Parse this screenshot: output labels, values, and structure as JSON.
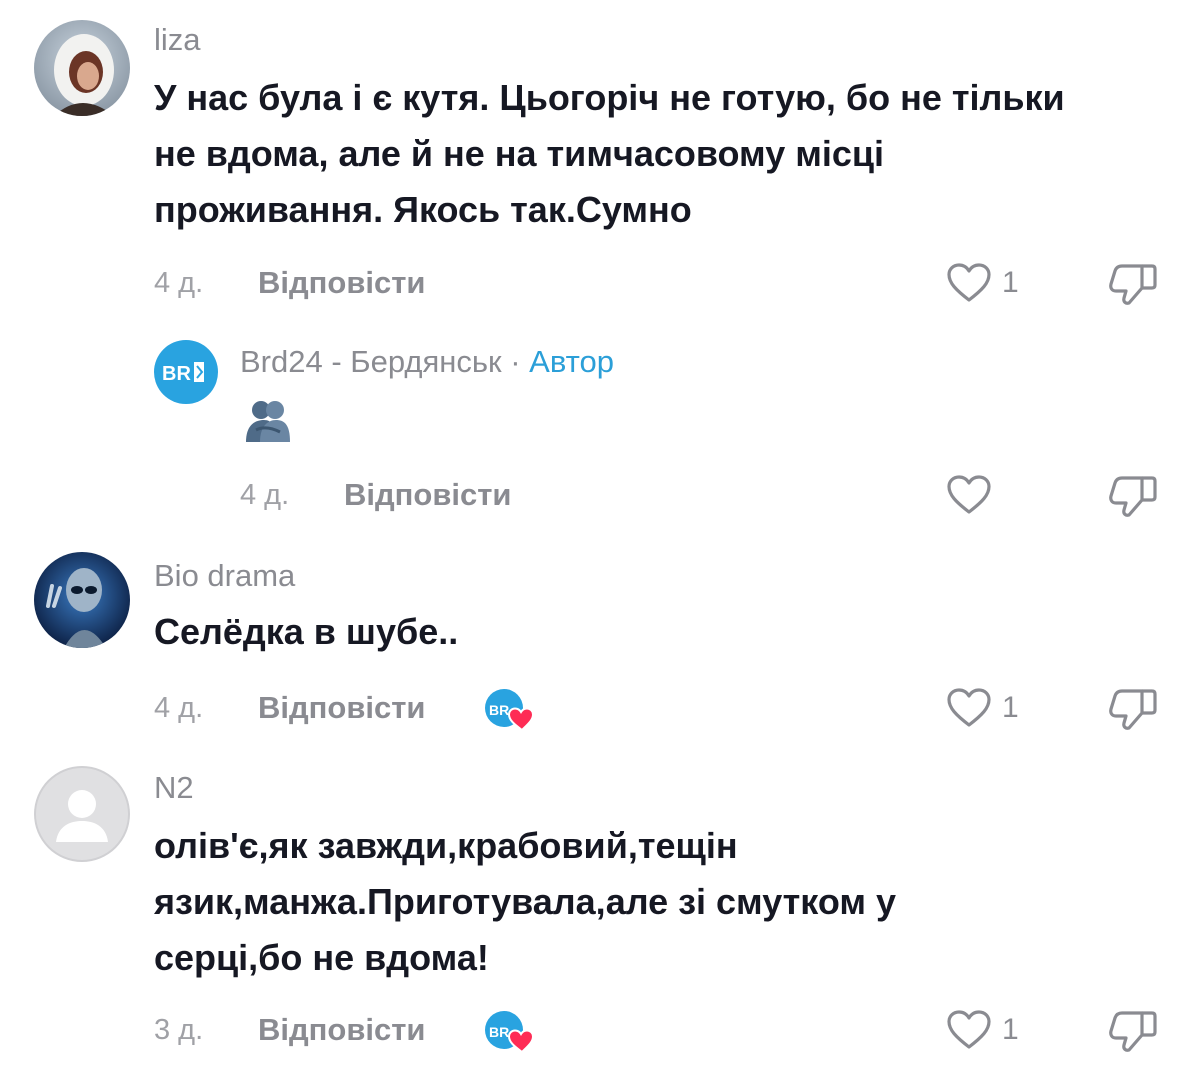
{
  "comments": [
    {
      "username": "liza",
      "lines": [
        "У нас була і є кутя. Цьогоріч не готую, бо не тільки",
        "не вдома, але й не на тимчасовому місці",
        "проживання. Якось так.Сумно"
      ],
      "time": "4 д.",
      "reply_label": "Відповісти",
      "likes": "1"
    },
    {
      "username": "Brd24 - Бердянськ",
      "separator": " · ",
      "author_label": "Автор",
      "avatar_text": "BRD",
      "time": "4 д.",
      "reply_label": "Відповісти"
    },
    {
      "username": "Bio drama",
      "lines": [
        "Селёдка в шубе.."
      ],
      "time": "4 д.",
      "reply_label": "Відповісти",
      "likes": "1"
    },
    {
      "username": "N2",
      "lines": [
        "олів'є,як завжди,крабовий,тещін",
        "язик,манжа.Приготувала,але зі смутком у",
        "серці,бо не вдома!"
      ],
      "time": "3 д.",
      "reply_label": "Відповісти",
      "likes": "1"
    }
  ],
  "icons": {
    "like": "heart-outline-icon",
    "dislike": "thumbs-down-icon",
    "liked_by_creator": "creator-heart-badge-icon",
    "emoji": "two-people-hugging-emoji"
  },
  "colors": {
    "text": "#161823",
    "muted": "#8a8b91",
    "author": "#2b9fd8",
    "heart": "#fe2c55"
  }
}
